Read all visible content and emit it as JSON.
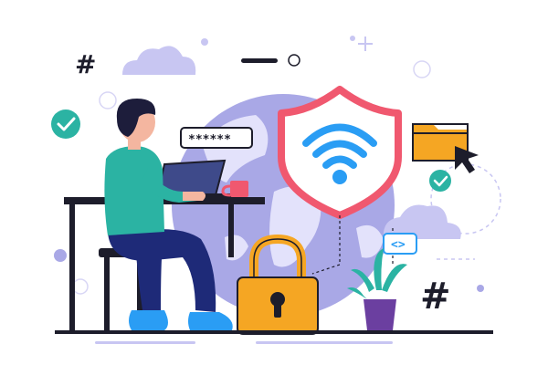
{
  "illustration": {
    "hash_symbol": "#",
    "password_mask": "******",
    "code_symbol": "<>",
    "icons": [
      "cloud-icon",
      "hash-icon",
      "checkmark-icon",
      "globe-icon",
      "shield-wifi-icon",
      "folder-icon",
      "cursor-icon",
      "padlock-icon",
      "code-brackets-icon",
      "potted-plant-icon",
      "laptop-icon",
      "coffee-mug-icon",
      "sparkle-icon"
    ],
    "colors": {
      "navy": "#1e2a78",
      "teal": "#2bb3a3",
      "blue": "#2a9df4",
      "globe": "#a9a8e6",
      "globe_land": "#e3e2fb",
      "shield_stroke": "#f0586f",
      "wifi": "#2a9df4",
      "lock_body": "#f5a623",
      "folder": "#f5a623",
      "check": "#2bb3a3",
      "cloud": "#c8c6f2",
      "plant_pot": "#6b3fa0",
      "plant_leaf": "#2bb3a3",
      "skin": "#f4b6a0",
      "hair": "#1d1d3b",
      "shirt": "#2bb3a3",
      "pants": "#1e2a78",
      "shoes": "#2a9df4",
      "mug": "#f0586f",
      "dark": "#1d1d2b"
    }
  }
}
